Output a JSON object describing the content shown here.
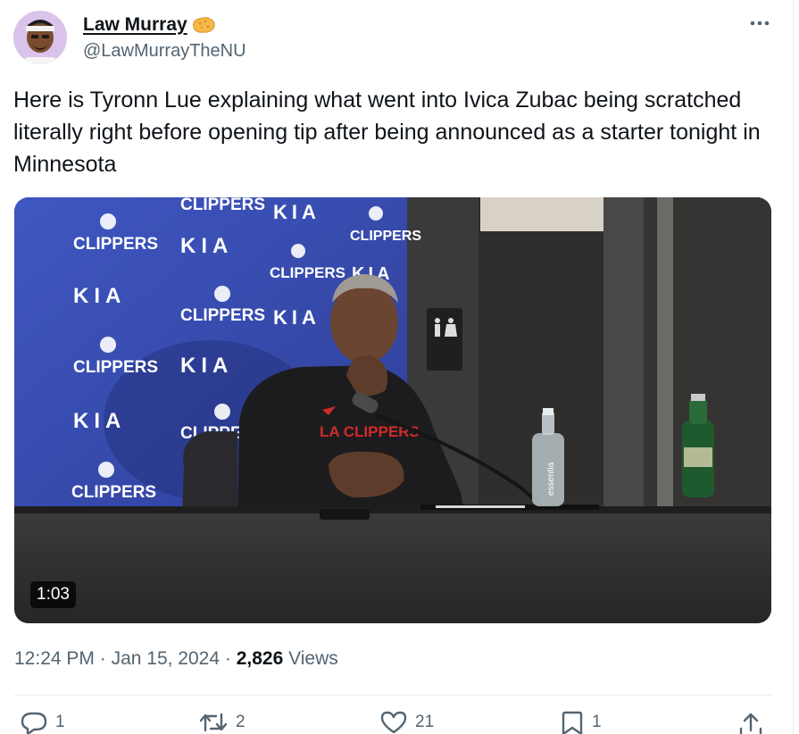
{
  "author": {
    "display_name": "Law Murray",
    "handle": "@LawMurrayTheNU"
  },
  "tweet": {
    "text": "Here is Tyronn Lue explaining what went into Ivica Zubac being scratched literally right before opening tip after being announced as a starter tonight in Minnesota"
  },
  "media": {
    "duration": "1:03",
    "backdrop_text": {
      "clippers": "CLIPPERS",
      "kia": "KIA",
      "hoodie_text": "LA CLIPPERS",
      "bottle_label": "essentia"
    }
  },
  "meta": {
    "time": "12:24 PM",
    "date": "Jan 15, 2024",
    "separator": "·",
    "views_count": "2,826",
    "views_label": "Views"
  },
  "actions": {
    "replies": "1",
    "reposts": "2",
    "likes": "21",
    "bookmarks": "1"
  },
  "icons": [
    "more-icon",
    "reply-icon",
    "repost-icon",
    "like-icon",
    "bookmark-icon",
    "share-icon",
    "emoji-icon"
  ],
  "colors": {
    "text_primary": "#0f1419",
    "text_secondary": "#536471",
    "divider": "#e6ecf0",
    "backdrop_blue": "#3a4fb0"
  }
}
